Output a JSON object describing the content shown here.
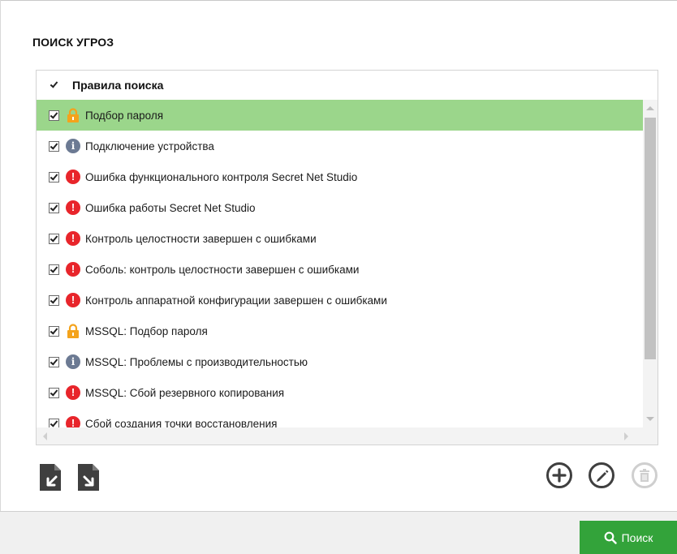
{
  "panel": {
    "title": "ПОИСК УГРОЗ",
    "list_header": "Правила поиска"
  },
  "rules": [
    {
      "label": "Подбор пароля",
      "icon": "lock-icon",
      "checked": true,
      "selected": true
    },
    {
      "label": "Подключение устройства",
      "icon": "info-icon",
      "checked": true
    },
    {
      "label": "Ошибка функционального контроля Secret Net Studio",
      "icon": "error-icon",
      "checked": true
    },
    {
      "label": "Ошибка работы Secret Net Studio",
      "icon": "error-icon",
      "checked": true
    },
    {
      "label": "Контроль целостности завершен с ошибками",
      "icon": "error-icon",
      "checked": true
    },
    {
      "label": "Соболь: контроль целостности завершен с ошибками",
      "icon": "error-icon",
      "checked": true
    },
    {
      "label": "Контроль аппаратной конфигурации завершен с ошибками",
      "icon": "error-icon",
      "checked": true
    },
    {
      "label": "MSSQL: Подбор пароля",
      "icon": "lock-icon",
      "checked": true
    },
    {
      "label": "MSSQL: Проблемы с производительностью",
      "icon": "info-icon",
      "checked": true
    },
    {
      "label": "MSSQL: Сбой резервного копирования",
      "icon": "error-icon",
      "checked": true
    },
    {
      "label": "Сбой создания точки восстановления",
      "icon": "error-icon",
      "checked": true
    }
  ],
  "footer": {
    "search_label": "Поиск"
  },
  "colors": {
    "selected_row": "#9bd68b",
    "error": "#e8252b",
    "info": "#6c7a93",
    "lock": "#f4a31c",
    "search_button": "#33a33a"
  }
}
